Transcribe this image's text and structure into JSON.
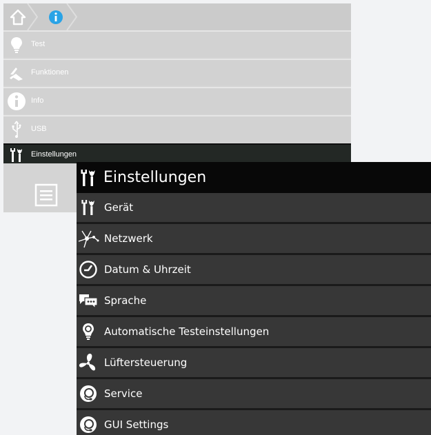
{
  "breadcrumb": {
    "home_icon": "home-icon",
    "info_icon": "info-icon"
  },
  "sidebar": {
    "items": [
      {
        "label": "Test",
        "icon": "lightbulb-icon"
      },
      {
        "label": "Funktionen",
        "icon": "functions-icon"
      },
      {
        "label": "Info",
        "icon": "info-icon"
      },
      {
        "label": "USB",
        "icon": "usb-icon"
      },
      {
        "label": "Einstellungen",
        "icon": "tools-icon",
        "active": true
      }
    ],
    "menu_icon": "menu-list-icon"
  },
  "settings": {
    "title": "Einstellungen",
    "items": [
      {
        "label": "Gerät",
        "icon": "tools-icon"
      },
      {
        "label": "Netzwerk",
        "icon": "network-icon"
      },
      {
        "label": "Datum & Uhrzeit",
        "icon": "clock-icon"
      },
      {
        "label": "Sprache",
        "icon": "chat-bubbles-icon"
      },
      {
        "label": "Automatische Testeinstellungen",
        "icon": "lightbulb-icon"
      },
      {
        "label": "Lüftersteuerung",
        "icon": "fan-icon"
      },
      {
        "label": "Service",
        "icon": "headset-icon"
      },
      {
        "label": "GUI Settings",
        "icon": "headset-icon"
      }
    ]
  },
  "colors": {
    "panel_bg": "#d4d4d4",
    "active_item_bg": "#232825",
    "window_bg": "#373737",
    "window_title_bg": "#080808",
    "breadcrumb_info": "#2aa3e6"
  }
}
